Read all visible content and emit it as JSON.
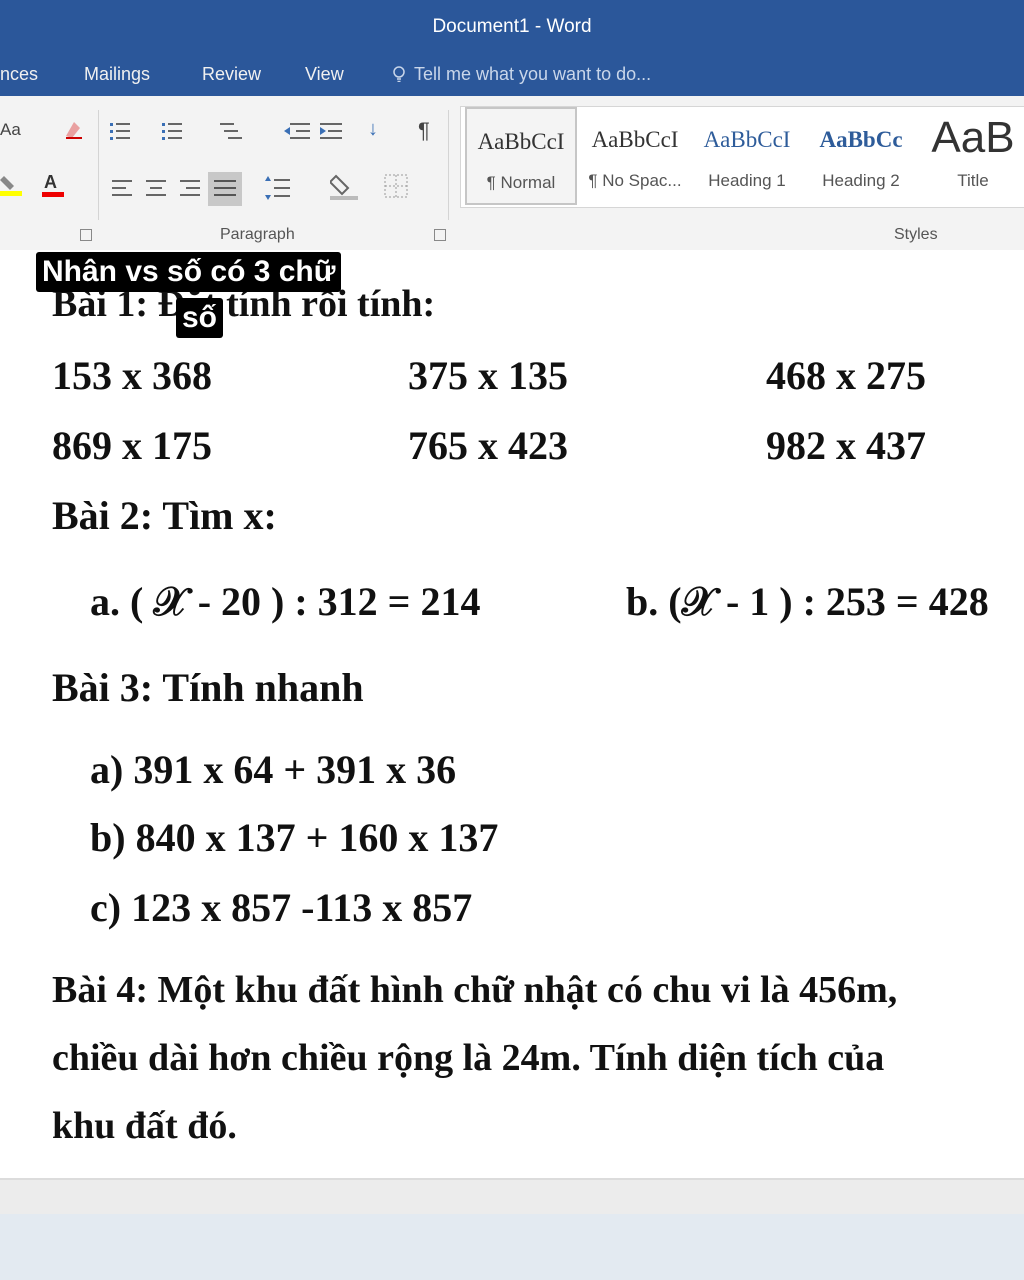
{
  "window": {
    "title": "Document1 - Word"
  },
  "tabs": [
    "nces",
    "Mailings",
    "Review",
    "View"
  ],
  "tell_me": {
    "placeholder": "Tell me what you want to do..."
  },
  "ribbon": {
    "paragraph_label": "Paragraph",
    "styles_label": "Styles",
    "font_case": "Aa",
    "sort_glyph": "↓",
    "pilcrow": "¶",
    "styles": [
      {
        "preview": "AaBbCcI",
        "name": "¶ Normal"
      },
      {
        "preview": "AaBbCcI",
        "name": "¶ No Spac..."
      },
      {
        "preview": "AaBbCcI",
        "name": "Heading 1"
      },
      {
        "preview": "AaBbCc",
        "name": "Heading 2"
      },
      {
        "preview": "AaB",
        "name": "Title"
      }
    ]
  },
  "caption": {
    "line1": "Nhân vs số có 3 chữ",
    "line2": "số"
  },
  "document": {
    "bai1": {
      "title": "Bài 1: Đặt tính rồi tính:",
      "row1": [
        "153 x 368",
        "375 x 135",
        "468 x 275"
      ],
      "row2": [
        "869 x 175",
        "765 x 423",
        "982 x 437"
      ]
    },
    "bai2": {
      "title": "Bài 2: Tìm x:",
      "a": "a. ( 𝒳 - 20 ) : 312 = 214",
      "b": "b. (𝒳 - 1 ) : 253 = 428"
    },
    "bai3": {
      "title": "Bài 3: Tính nhanh",
      "a": "a) 391 x 64 + 391 x 36",
      "b": "b) 840 x 137 + 160 x 137",
      "c": "c) 123 x 857 -113 x 857"
    },
    "bai4": {
      "line1": "Bài 4: Một khu đất hình chữ nhật có chu vi là 456m,",
      "line2": "chiều dài hơn chiều rộng là 24m. Tính diện tích của",
      "line3": "khu đất đó."
    }
  }
}
